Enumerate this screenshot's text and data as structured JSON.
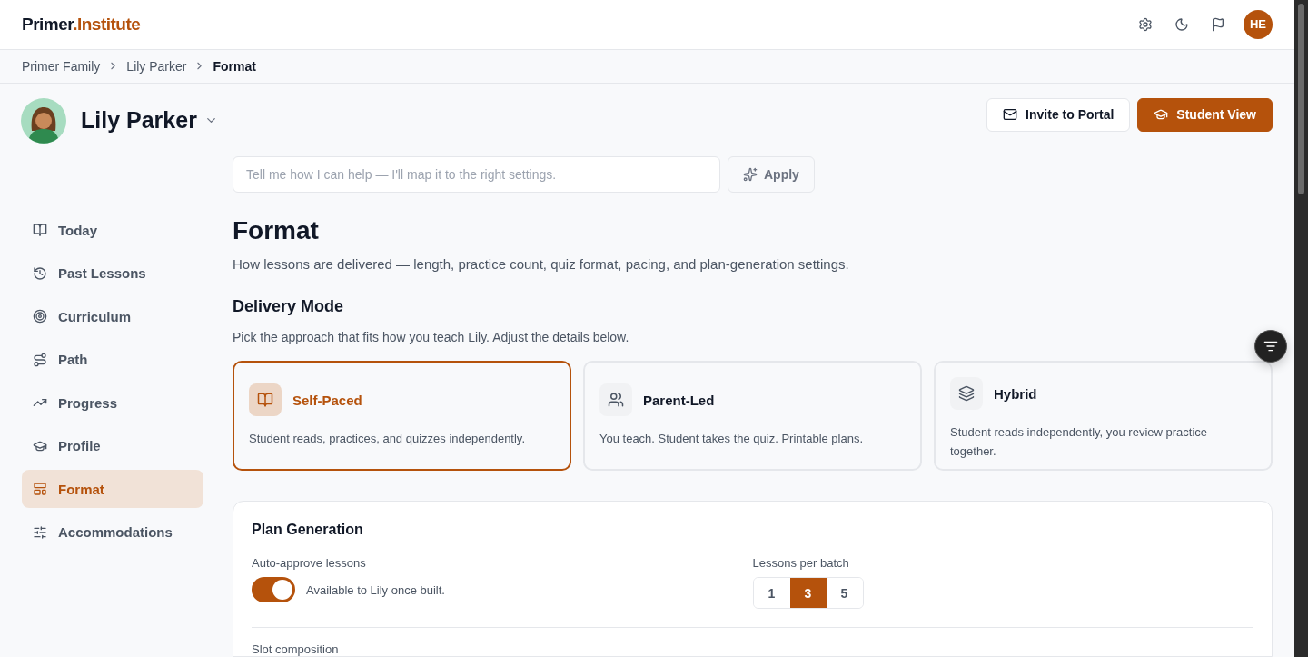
{
  "topbar": {
    "logo": {
      "primary": "Primer",
      "accent": ".Institute"
    },
    "user_initials": "HE"
  },
  "breadcrumb": [
    {
      "label": "Primer Family",
      "current": false
    },
    {
      "label": "Lily Parker",
      "current": false
    },
    {
      "label": "Format",
      "current": true
    }
  ],
  "student": {
    "name": "Lily Parker"
  },
  "actions": [
    {
      "label": "Invite to Portal",
      "kind": "secondary"
    },
    {
      "label": "Student View",
      "kind": "primary"
    }
  ],
  "assistant": {
    "placeholder": "Tell me how I can help — I'll map it to the right settings.",
    "button": "Apply"
  },
  "sidebar": {
    "items": [
      {
        "label": "Today",
        "selected": false
      },
      {
        "label": "Past Lessons",
        "selected": false
      },
      {
        "label": "Curriculum",
        "selected": false
      },
      {
        "label": "Path",
        "selected": false
      },
      {
        "label": "Progress",
        "selected": false
      },
      {
        "label": "Profile",
        "selected": false
      },
      {
        "label": "Format",
        "selected": true
      },
      {
        "label": "Accommodations",
        "selected": false
      }
    ]
  },
  "page": {
    "title": "Format",
    "description": "How lessons are delivered — length, practice count, quiz format, pacing, and plan-generation settings."
  },
  "delivery_mode": {
    "title": "Delivery Mode",
    "subtitle": "Pick the approach that fits how you teach Lily. Adjust the details below.",
    "options": [
      {
        "title": "Self-Paced",
        "description": "Student reads, practices, and quizzes independently.",
        "selected": true
      },
      {
        "title": "Parent-Led",
        "description": "You teach. Student takes the quiz. Printable plans.",
        "selected": false
      },
      {
        "title": "Hybrid",
        "description": "Student reads independently, you review practice together.",
        "selected": false
      }
    ]
  },
  "plan_generation": {
    "title": "Plan Generation",
    "auto_approve": {
      "label": "Auto-approve lessons",
      "on": true,
      "note": "Available to Lily once built."
    },
    "lessons_per_batch": {
      "label": "Lessons per batch",
      "options": [
        {
          "label": "1",
          "selected": false
        },
        {
          "label": "3",
          "selected": true
        },
        {
          "label": "5",
          "selected": false
        }
      ]
    },
    "next_label": "Slot composition"
  }
}
